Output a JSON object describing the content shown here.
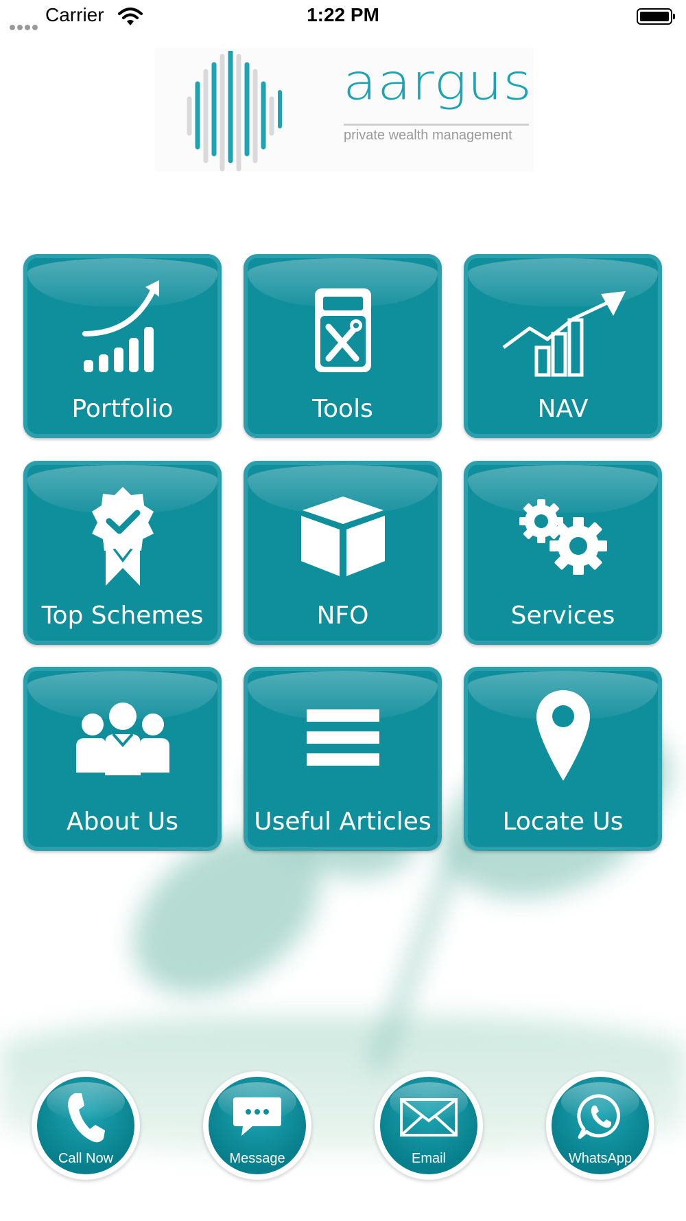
{
  "status_bar": {
    "carrier": "Carrier",
    "time": "1:22 PM"
  },
  "logo": {
    "brand_name": "aargus",
    "tagline": "private wealth management",
    "accent_color": "#1da3b1"
  },
  "tiles": [
    {
      "label": "Portfolio",
      "icon": "growth-chart-icon"
    },
    {
      "label": "Tools",
      "icon": "calculator-tools-icon"
    },
    {
      "label": "NAV",
      "icon": "trend-up-icon"
    },
    {
      "label": "Top Schemes",
      "icon": "award-badge-icon"
    },
    {
      "label": "NFO",
      "icon": "box-icon"
    },
    {
      "label": "Services",
      "icon": "gears-icon"
    },
    {
      "label": "About Us",
      "icon": "team-icon"
    },
    {
      "label": "Useful Articles",
      "icon": "menu-lines-icon"
    },
    {
      "label": "Locate Us",
      "icon": "map-pin-icon"
    }
  ],
  "actions": [
    {
      "label": "Call Now",
      "icon": "phone-icon"
    },
    {
      "label": "Message",
      "icon": "chat-bubble-icon"
    },
    {
      "label": "Email",
      "icon": "envelope-icon"
    },
    {
      "label": "WhatsApp",
      "icon": "whatsapp-icon"
    }
  ],
  "colors": {
    "tile": "#0f8e9c",
    "tile_border": "#2c9fac"
  }
}
